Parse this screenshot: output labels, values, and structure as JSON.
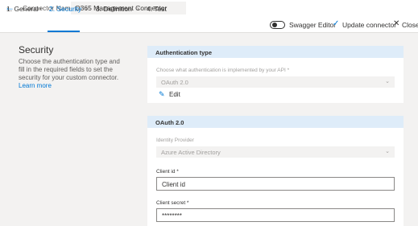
{
  "header": {
    "back_icon": "arrow-left-icon",
    "connector_name_label": "Connector Name",
    "connector_name_value": "O365 Management Connector"
  },
  "steps": [
    {
      "label": "1. General"
    },
    {
      "label": "2. Security"
    },
    {
      "label": "3. Definition"
    },
    {
      "label": "4. Test"
    }
  ],
  "toolbar": {
    "swagger_label": "Swagger Editor",
    "update_label": "Update connector",
    "close_label": "Close"
  },
  "sidebar": {
    "title": "Security",
    "description": "Choose the authentication type and fill in the required fields to set the security for your custom connector.",
    "link": "Learn more"
  },
  "auth_card": {
    "header": "Authentication type",
    "question": "Choose what authentication is implemented by your API *",
    "selected": "OAuth 2.0",
    "edit_label": "Edit"
  },
  "oauth_card": {
    "header": "OAuth 2.0",
    "identity_label": "Identity Provider",
    "identity_value": "Azure Active Directory",
    "client_id_label": "Client id *",
    "client_id_value": "Client id",
    "client_secret_label": "Client secret *",
    "client_secret_value": "********"
  },
  "colors": {
    "accent": "#0078d4",
    "card_header": "#deecf9",
    "background": "#f3f2f1"
  }
}
